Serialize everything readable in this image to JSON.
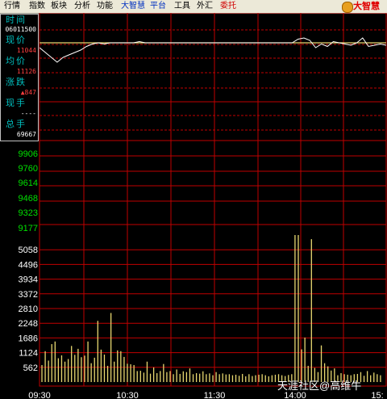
{
  "menu": [
    {
      "label": "行情",
      "color": "#000000"
    },
    {
      "label": "指数",
      "color": "#000000"
    },
    {
      "label": "板块",
      "color": "#000000"
    },
    {
      "label": "分析",
      "color": "#000000"
    },
    {
      "label": "功能",
      "color": "#000000"
    },
    {
      "label": "大智慧",
      "color": "#0030c0"
    },
    {
      "label": "平台",
      "color": "#0030c0"
    },
    {
      "label": "工具",
      "color": "#000000"
    },
    {
      "label": "外汇",
      "color": "#000000"
    },
    {
      "label": "委托",
      "color": "#d00000"
    }
  ],
  "logo": {
    "text": "大智慧",
    "icon": "dzh-logo-icon"
  },
  "infobox": {
    "time_label": "时间",
    "time_value": "06011500",
    "price_label": "现价",
    "price_value": "11044",
    "avg_label": "均价",
    "avg_value": "11126",
    "change_label": "涨跌",
    "change_value": "▲847",
    "hand_label": "现手",
    "hand_value": "----",
    "total_label": "总手",
    "total_value": "69667"
  },
  "watermark": "天涯社区@高维牛",
  "chart_data": {
    "type": "line+bar",
    "x_ticks": [
      "09:30",
      "10:30",
      "11:30",
      "14:00",
      "15:"
    ],
    "price_ticks": [
      "9906",
      "9760",
      "9614",
      "9468",
      "9323",
      "9177"
    ],
    "volume_ticks": [
      "5058",
      "4496",
      "3934",
      "3372",
      "2810",
      "2248",
      "1686",
      "1124",
      "562"
    ],
    "volume_ylim": [
      0,
      5620
    ],
    "price_line": {
      "color": "#ffffff",
      "values": [
        0.92,
        0.88,
        0.84,
        0.8,
        0.84,
        0.86,
        0.88,
        0.9,
        0.93,
        0.95,
        0.96,
        0.95,
        0.96,
        0.96,
        0.96,
        0.96,
        0.96,
        0.97,
        0.96,
        0.96,
        0.96,
        0.96,
        0.96,
        0.96,
        0.96,
        0.96,
        0.96,
        0.96,
        0.96,
        0.96,
        0.96,
        0.96,
        0.96,
        0.96,
        0.96,
        0.96,
        0.96,
        0.96,
        0.96,
        0.96,
        0.96,
        0.96,
        0.96,
        0.96,
        0.99,
        1.0,
        0.98,
        0.92,
        0.95,
        0.93,
        0.97,
        0.96,
        0.95,
        0.94,
        0.96,
        1.0,
        0.93,
        0.94,
        0.95,
        0.94
      ]
    },
    "avg_line": {
      "color": "#e8d870",
      "value": 0.96
    },
    "volume_bars": {
      "color": "#e8d870",
      "values": [
        650,
        1180,
        820,
        1450,
        1550,
        910,
        1020,
        780,
        880,
        1380,
        1040,
        1270,
        950,
        1010,
        1550,
        720,
        930,
        2340,
        1240,
        1050,
        620,
        2640,
        780,
        1210,
        1180,
        960,
        700,
        680,
        650,
        420,
        430,
        360,
        780,
        320,
        560,
        340,
        420,
        690,
        380,
        420,
        300,
        480,
        310,
        410,
        380,
        520,
        300,
        340,
        320,
        410,
        300,
        330,
        260,
        380,
        300,
        330,
        290,
        300,
        260,
        280,
        240,
        310,
        220,
        300,
        230,
        260,
        280,
        300,
        260,
        220,
        260,
        280,
        300,
        260,
        230,
        270,
        300,
        5850,
        5800,
        1250,
        1700,
        620,
        5460,
        540,
        380,
        1400,
        720,
        600,
        440,
        520,
        260,
        340,
        300,
        280,
        260,
        300,
        310,
        380,
        240,
        420,
        260,
        360,
        300,
        260
      ]
    }
  }
}
